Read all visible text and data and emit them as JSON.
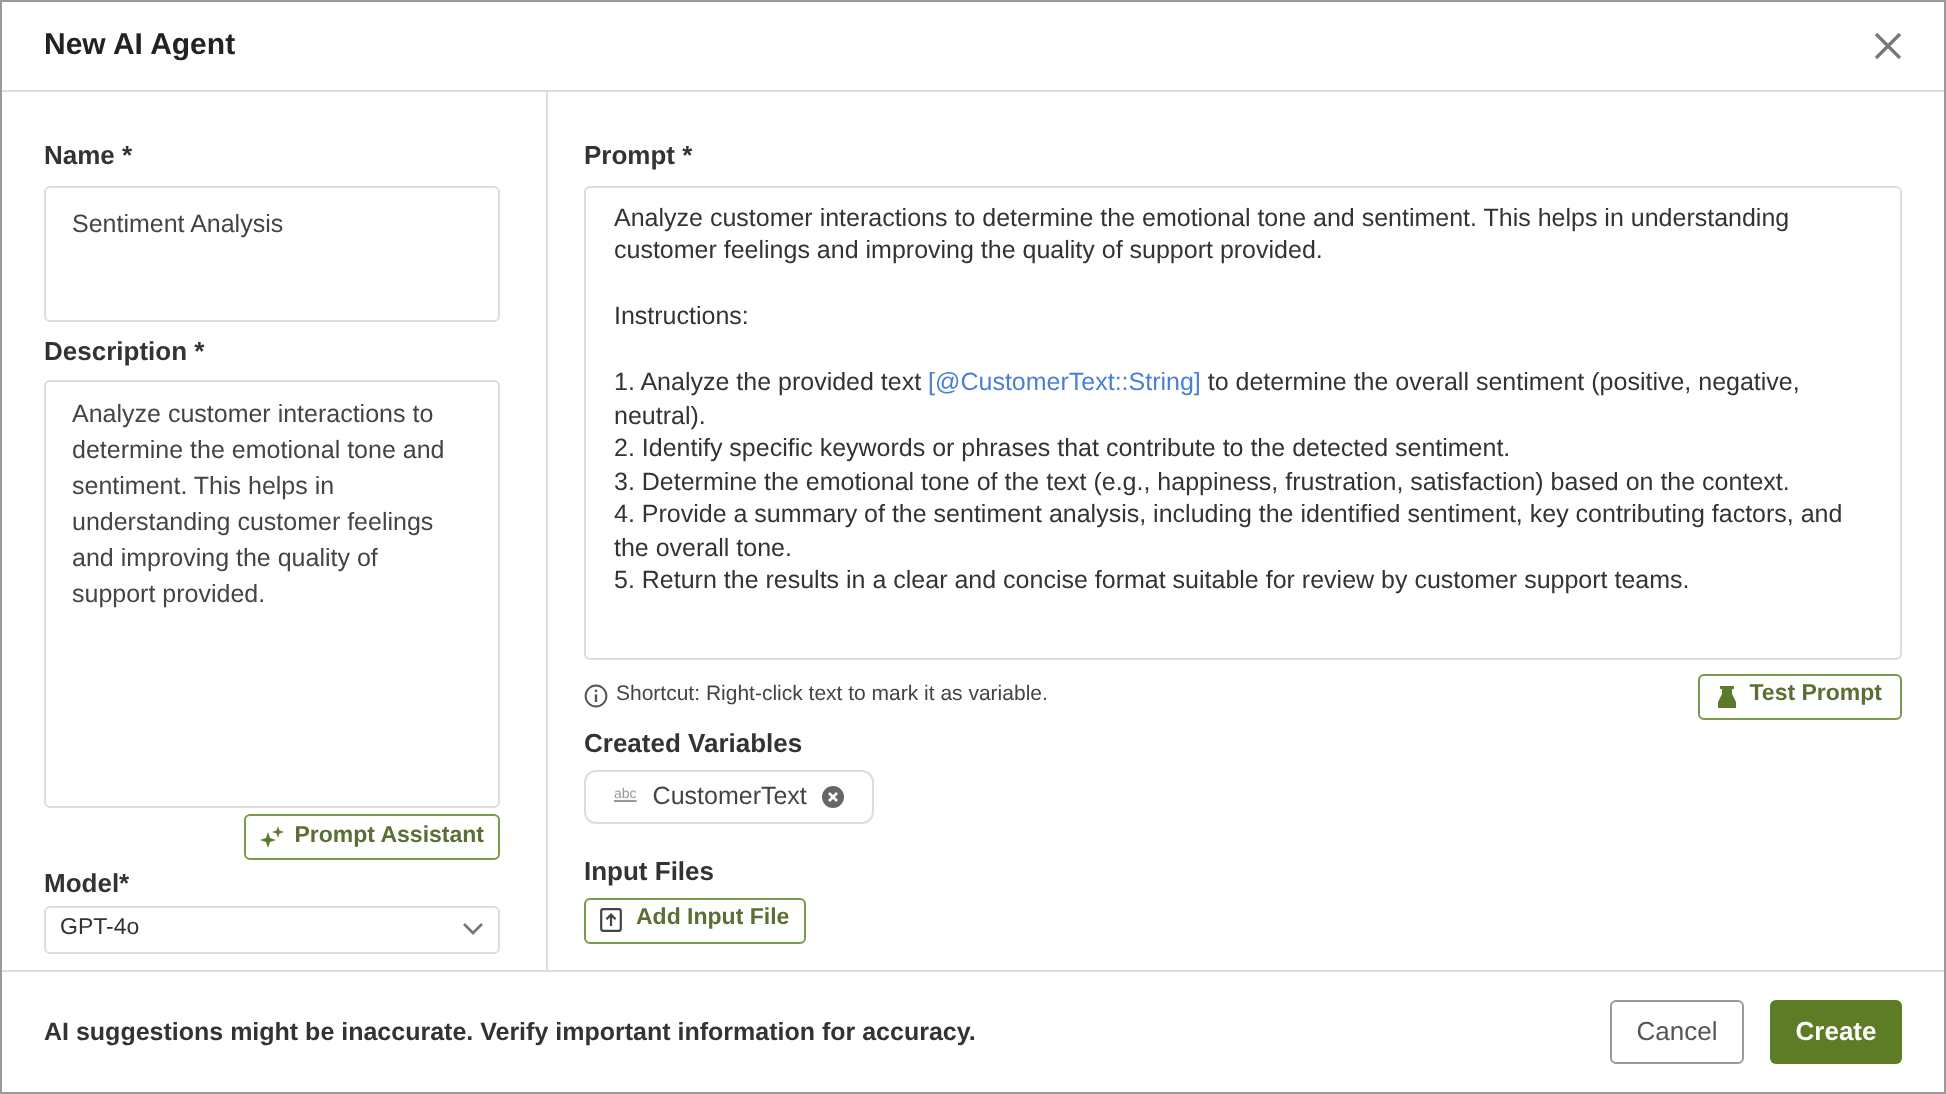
{
  "dialog": {
    "title": "New AI Agent"
  },
  "name_field": {
    "label": "Name *",
    "value": "Sentiment Analysis"
  },
  "description_field": {
    "label": "Description *",
    "value": "Analyze customer interactions to determine the emotional tone and sentiment. This helps in understanding customer feelings and improving the quality of support provided."
  },
  "prompt_assistant_button": {
    "label": "Prompt Assistant"
  },
  "model_field": {
    "label": "Model*",
    "value": "GPT-4o"
  },
  "prompt_field": {
    "label": "Prompt *",
    "blocks": [
      [
        [
          {
            "kind": "text",
            "text": "Analyze customer interactions to determine the emotional tone and sentiment. This helps in understanding customer feelings and improving the quality of support provided."
          }
        ]
      ],
      [
        [
          {
            "kind": "text",
            "text": "Instructions:"
          }
        ]
      ],
      [
        [
          {
            "kind": "text",
            "text": "1. Analyze the provided text "
          },
          {
            "kind": "variable",
            "text": "[@CustomerText::String]"
          },
          {
            "kind": "text",
            "text": " to determine the overall sentiment (positive, negative, neutral)."
          }
        ],
        [
          {
            "kind": "text",
            "text": "2. Identify specific keywords or phrases that contribute to the detected sentiment."
          }
        ],
        [
          {
            "kind": "text",
            "text": "3. Determine the emotional tone of the text (e.g., happiness, frustration, satisfaction) based on the context."
          }
        ],
        [
          {
            "kind": "text",
            "text": "4. Provide a summary of the sentiment analysis, including the identified sentiment, key contributing factors, and the overall tone."
          }
        ],
        [
          {
            "kind": "text",
            "text": "5. Return the results in a clear and concise format suitable for review by customer support teams."
          }
        ]
      ]
    ]
  },
  "shortcut_hint": "Shortcut: Right-click text to mark it as variable.",
  "test_prompt_button": {
    "label": "Test Prompt"
  },
  "created_variables": {
    "label": "Created Variables",
    "items": [
      {
        "type_tag": "abc",
        "name": "CustomerText"
      }
    ]
  },
  "input_files": {
    "label": "Input Files",
    "button": "Add Input File"
  },
  "footer": {
    "notice": "AI suggestions might be inaccurate. Verify important information for accuracy.",
    "buttons": [
      {
        "label": "Cancel",
        "kind": "secondary"
      },
      {
        "label": "Create",
        "kind": "primary"
      }
    ]
  }
}
